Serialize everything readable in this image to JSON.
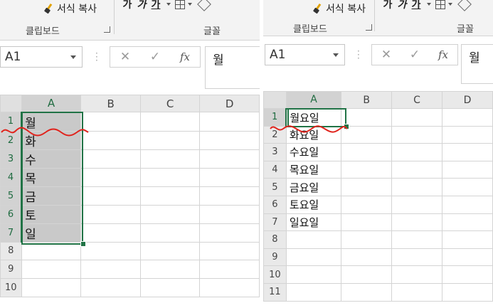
{
  "colors": {
    "accent": "#217346",
    "annotation": "#e0231c"
  },
  "left": {
    "ribbon": {
      "top_partial": "",
      "format_painter": "서식 복사",
      "font_btns": [
        "가",
        "가",
        "가"
      ],
      "group_clipboard": "클립보드",
      "group_font": "글꼴"
    },
    "formula_bar": {
      "name_box": "A1",
      "content": "월"
    },
    "columns": [
      "A",
      "B",
      "C",
      "D"
    ],
    "rows": [
      "1",
      "2",
      "3",
      "4",
      "5",
      "6",
      "7",
      "8",
      "9",
      "10"
    ],
    "cells_a": [
      "월",
      "화",
      "수",
      "목",
      "금",
      "토",
      "일",
      "",
      "",
      ""
    ]
  },
  "right": {
    "ribbon": {
      "top_partial": "",
      "format_painter": "서식 복사",
      "font_btns": [
        "가",
        "가",
        "가"
      ],
      "group_clipboard": "클립보드",
      "group_font": "글꼴"
    },
    "formula_bar": {
      "name_box": "A1",
      "content": "월"
    },
    "columns": [
      "A",
      "B",
      "C",
      "D"
    ],
    "rows": [
      "1",
      "2",
      "3",
      "4",
      "5",
      "6",
      "7",
      "8",
      "9",
      "10",
      "11"
    ],
    "cells_a": [
      "월요일",
      "화요일",
      "수요일",
      "목요일",
      "금요일",
      "토요일",
      "일요일",
      "",
      "",
      "",
      ""
    ]
  },
  "icons": [
    "format-painter-icon",
    "bold-icon",
    "italic-icon",
    "underline-icon",
    "border-icon",
    "fill-color-icon",
    "cancel-x-icon",
    "enter-check-icon",
    "fx-icon",
    "dropdown-icon"
  ]
}
